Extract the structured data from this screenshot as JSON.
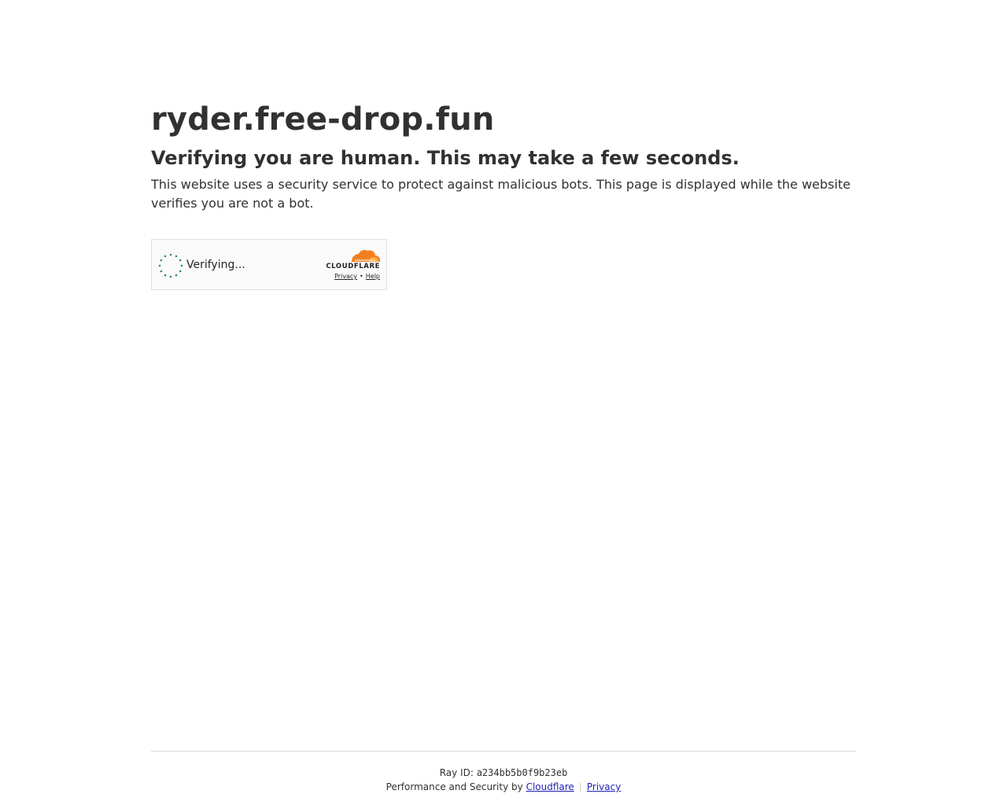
{
  "page": {
    "site_title": "ryder.free-drop.fun",
    "subtitle": "Verifying you are human. This may take a few seconds.",
    "description": "This website uses a security service to protect against malicious bots. This page is displayed while the website verifies you are not a bot."
  },
  "widget": {
    "status_text": "Verifying...",
    "brand_wordmark": "CLOUDFLARE",
    "privacy_link": "Privacy",
    "link_separator": "•",
    "help_link": "Help",
    "spinner_icon": "loading-spinner-icon",
    "logo_icon": "cloudflare-cloud-icon"
  },
  "footer": {
    "ray_label": "Ray ID:",
    "ray_id": "a234bb5b0f9b23eb",
    "perf_text": "Performance and Security by",
    "cloudflare_link": "Cloudflare",
    "separator": "|",
    "privacy_link": "Privacy"
  },
  "colors": {
    "text": "#313131",
    "spinner": "#2f8f5b",
    "cloud_orange": "#f38020",
    "cloud_light": "#faae40",
    "link": "#1f1fb3"
  }
}
